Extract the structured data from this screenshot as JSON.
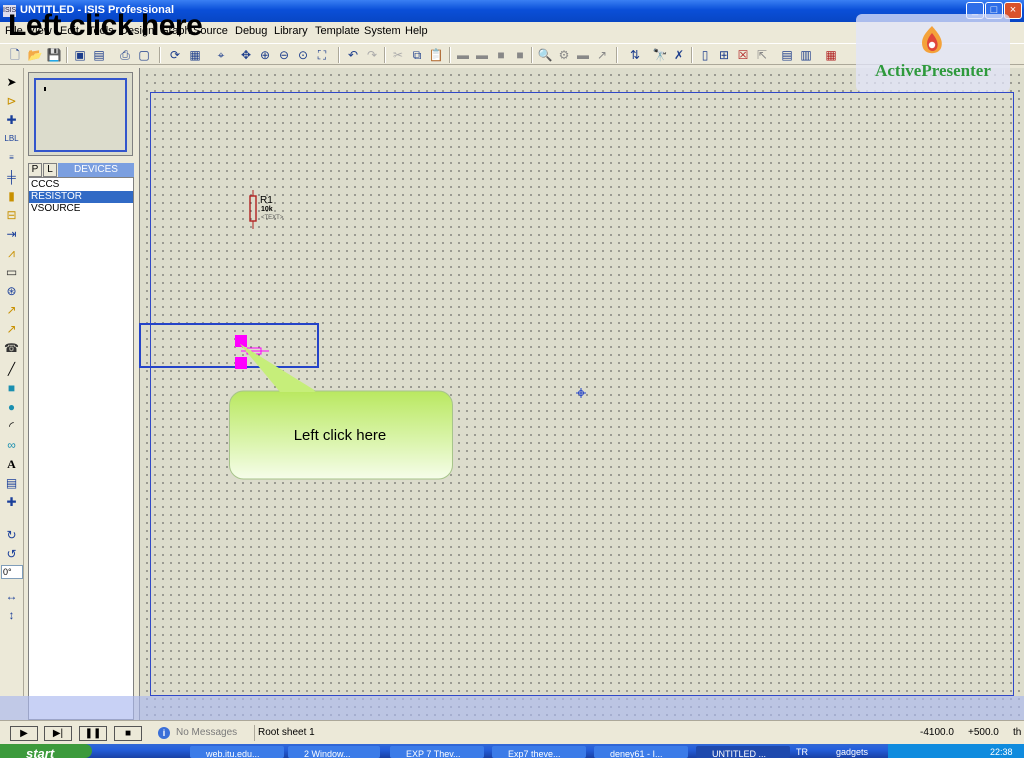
{
  "overlay_caption": "Left click here",
  "window": {
    "title": "UNTITLED - ISIS Professional",
    "icon_text": "ISIS",
    "controls": {
      "minimize": "_",
      "maximize": "□",
      "close": "×"
    }
  },
  "menu": [
    "File",
    "View",
    "Edit",
    "Tools",
    "Design",
    "Graph",
    "Source",
    "Debug",
    "Library",
    "Template",
    "System",
    "Help"
  ],
  "toolbar": {
    "icons": [
      "new-file-icon",
      "open-file-icon",
      "save-icon",
      "import-icon",
      "export-icon",
      "print-icon",
      "mark-area-icon",
      "refresh-icon",
      "grid-icon",
      "origin-icon",
      "pan-icon",
      "zoom-in-icon",
      "zoom-out-icon",
      "zoom-all-icon",
      "zoom-area-icon",
      "undo-icon",
      "redo-icon",
      "cut-icon",
      "copy-icon",
      "paste-icon",
      "block-copy-icon",
      "block-move-icon",
      "block-rotate-icon",
      "block-delete-icon",
      "pick-device-icon",
      "make-device-icon",
      "packaging-icon",
      "decompose-icon",
      "wire-autorouter-icon",
      "search-icon",
      "property-tool-icon",
      "new-sheet-icon",
      "remove-sheet-icon",
      "goto-sheet-icon",
      "zoom-child-icon",
      "netlist-icon",
      "bom-icon",
      "erc-icon"
    ]
  },
  "logo": {
    "name": "ActivePresenter"
  },
  "modes": [
    "selection-mode-icon",
    "component-mode-icon",
    "junction-dot-icon",
    "wire-label-icon",
    "text-script-icon",
    "bus-icon",
    "subcircuit-icon",
    "terminal-icon",
    "device-pin-icon",
    "graph-icon",
    "tape-recorder-icon",
    "generator-icon",
    "voltage-probe-icon",
    "current-probe-icon",
    "virtual-instrument-icon",
    "line-icon",
    "box-icon",
    "circle-icon",
    "arc-icon",
    "path-icon",
    "text-icon",
    "symbol-icon",
    "marker-icon",
    "rotate-cw-icon",
    "rotate-ccw-icon",
    "flip-horizontal-icon",
    "flip-vertical-icon"
  ],
  "rotation": "0°",
  "devices_panel": {
    "tabs": [
      "P",
      "L"
    ],
    "title": "DEVICES",
    "items": [
      "CCCS",
      "RESISTOR",
      "VSOURCE"
    ],
    "selected": 1
  },
  "schematic": {
    "resistor": {
      "ref": "R1",
      "value": "10k",
      "text": "<TEXT>"
    }
  },
  "callout": {
    "text": "Left click here"
  },
  "status": {
    "sim_buttons": [
      "play-icon",
      "step-icon",
      "pause-icon",
      "stop-icon"
    ],
    "messages": "No Messages",
    "sheet": "Root sheet 1",
    "x": "-4100.0",
    "y": "+500.0",
    "unit": "th"
  },
  "taskbar": {
    "start": "start",
    "tasks": [
      "web.itu.edu...",
      "2 Window...",
      "EXP 7 Thev...",
      "Exp7 theve...",
      "deney61 - I...",
      "UNTITLED ..."
    ],
    "active_task": 5,
    "tray_lang": "TR",
    "gadgets": "gadgets",
    "clock": "22:38"
  },
  "colors": {
    "canvas": "#dcdccc",
    "sheet_border": "#3048c8",
    "selection": "#316ac5",
    "ghost": "#ff00ff",
    "callout": "#c6ee7a"
  }
}
